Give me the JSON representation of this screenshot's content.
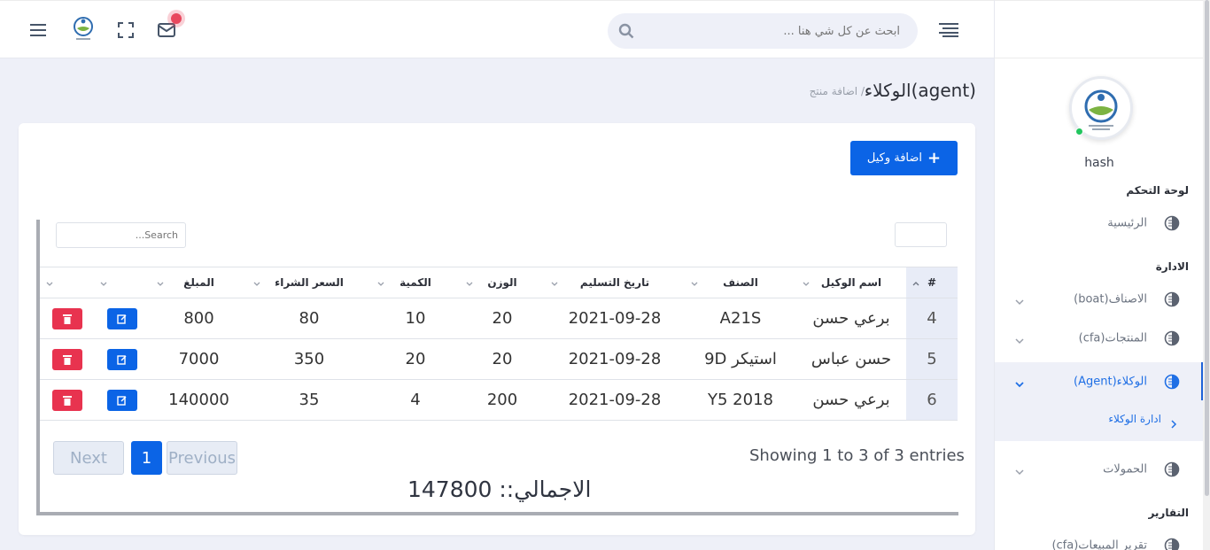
{
  "topbar": {
    "search_placeholder": "ابحث عن كل شي هنا ..."
  },
  "sidebar": {
    "username": "hash",
    "sections": {
      "dashboard": "لوحة التحكم",
      "admin": "الادارة",
      "reports": "التقارير"
    },
    "items": [
      {
        "label": "الرئيسية"
      },
      {
        "label": "الاصناف(boat)"
      },
      {
        "label": "المنتجات(cfa)"
      },
      {
        "label": "الوكلاء(Agent)"
      },
      {
        "label": "الحمولات"
      },
      {
        "label": "تقرير المبيعات(cfa)"
      }
    ],
    "sub_item": "ادارة الوكلاء"
  },
  "page": {
    "title": "الوكلاء(agent)",
    "breadcrumb": "/ اضافة منتج",
    "add_button": "اضافة وكيل",
    "table_search_placeholder": "Search..."
  },
  "table": {
    "columns": [
      "#",
      "اسم الوكيل",
      "الصنف",
      "تاريخ التسليم",
      "الوزن",
      "الكمية",
      "السعر الشراء",
      "المبلغ",
      "",
      ""
    ],
    "rows": [
      {
        "id": "4",
        "agent": "برعي حسن",
        "category": "A21S",
        "date": "2021-09-28",
        "weight": "20",
        "qty": "10",
        "price": "80",
        "amount": "800"
      },
      {
        "id": "5",
        "agent": "حسن عباس",
        "category": "استيكر 9D",
        "date": "2021-09-28",
        "weight": "20",
        "qty": "20",
        "price": "350",
        "amount": "7000"
      },
      {
        "id": "6",
        "agent": "برعي حسن",
        "category": "Y5 2018",
        "date": "2021-09-28",
        "weight": "200",
        "qty": "4",
        "price": "35",
        "amount": "140000"
      }
    ],
    "info": "Showing 1 to 3 of 3 entries",
    "pagination": {
      "previous": "Previous",
      "current": "1",
      "next": "Next"
    },
    "total": "الاجمالي:: 147800"
  },
  "colors": {
    "primary": "#0b64e6",
    "danger": "#e8334f",
    "background": "#eef0f8"
  }
}
